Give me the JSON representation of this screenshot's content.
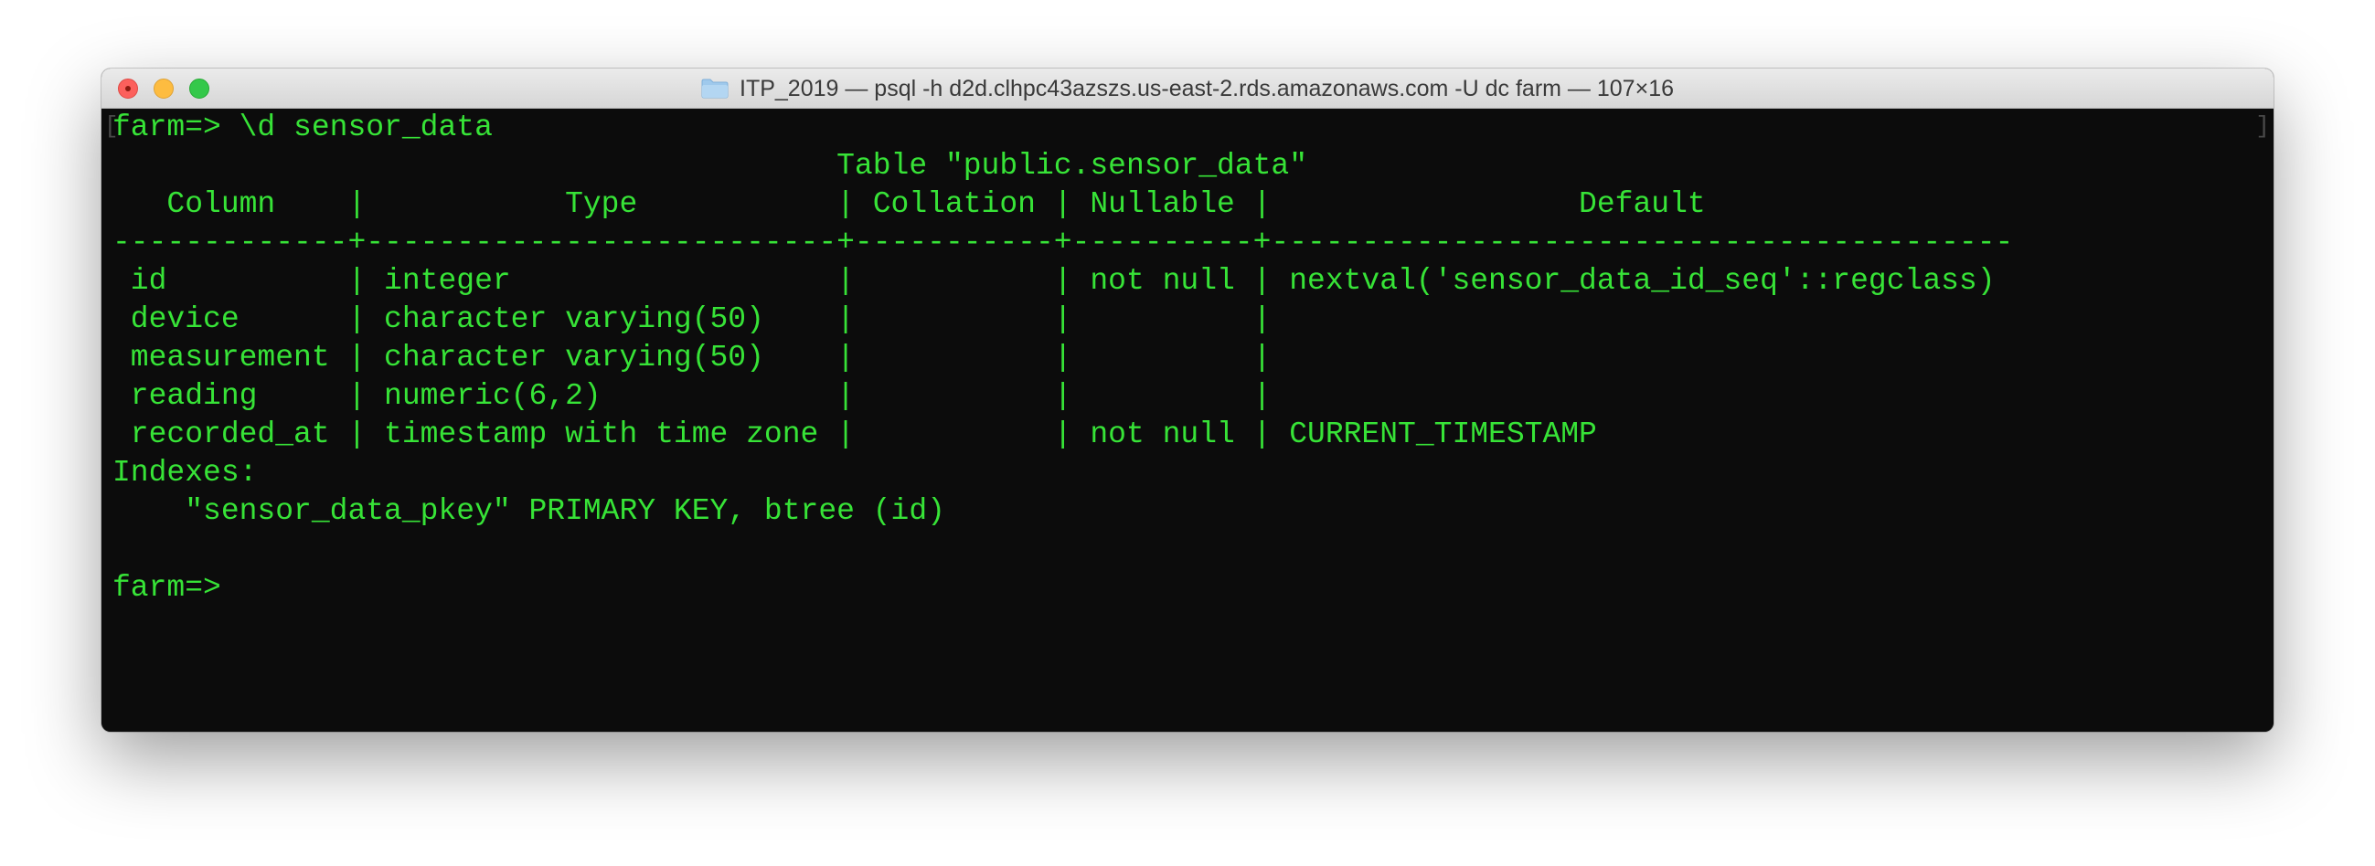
{
  "window": {
    "title": "ITP_2019 — psql -h d2d.clhpc43azszs.us-east-2.rds.amazonaws.com -U dc farm — 107×16",
    "title_icon": "folder-icon"
  },
  "colors": {
    "terminal_text": "#37e337",
    "terminal_background": "#0c0c0c"
  },
  "terminal": {
    "lines": [
      "farm=> \\d sensor_data",
      "                                        Table \"public.sensor_data\"",
      "   Column    |           Type           | Collation | Nullable |                 Default",
      "-------------+--------------------------+-----------+----------+-----------------------------------------",
      " id          | integer                  |           | not null | nextval('sensor_data_id_seq'::regclass)",
      " device      | character varying(50)    |           |          |",
      " measurement | character varying(50)    |           |          |",
      " reading     | numeric(6,2)             |           |          |",
      " recorded_at | timestamp with time zone |           | not null | CURRENT_TIMESTAMP",
      "Indexes:",
      "    \"sensor_data_pkey\" PRIMARY KEY, btree (id)",
      "",
      "farm=> "
    ]
  }
}
